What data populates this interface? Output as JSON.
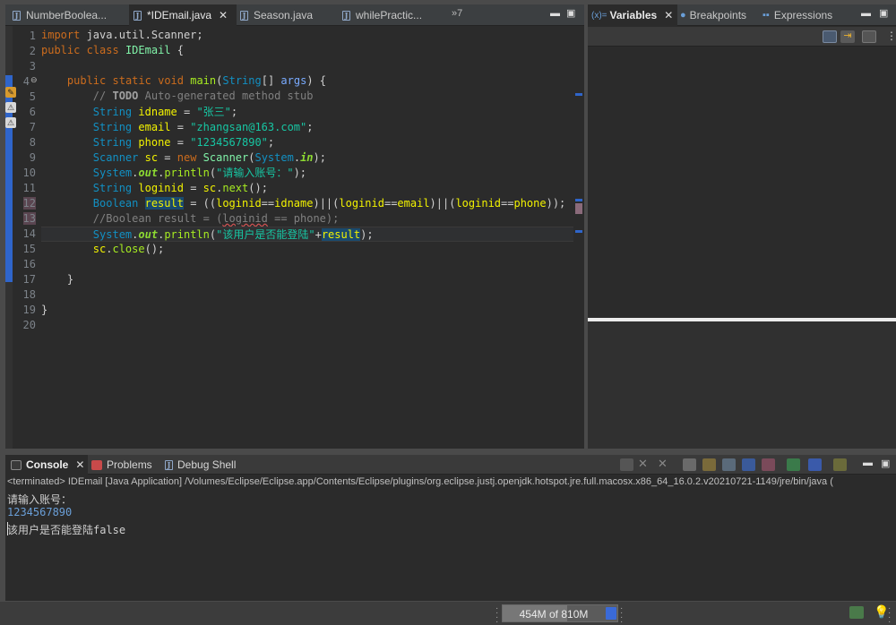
{
  "editor": {
    "tabs": [
      {
        "label": "NumberBoolea...",
        "active": false
      },
      {
        "label": "*IDEmail.java",
        "active": true
      },
      {
        "label": "Season.java",
        "active": false
      },
      {
        "label": "whilePractic...",
        "active": false
      }
    ],
    "overflow_label": "»7",
    "line_numbers": [
      "1",
      "2",
      "3",
      "4",
      "5",
      "6",
      "7",
      "8",
      "9",
      "10",
      "11",
      "12",
      "13",
      "14",
      "15",
      "16",
      "17",
      "18",
      "19",
      "20"
    ],
    "code": {
      "l1_kw": "import",
      "l1_rest": " java.util.Scanner;",
      "l2_kw1": "public",
      "l2_kw2": "class",
      "l2_name": "IDEmail",
      "l2_brace": " {",
      "l4_kw1": "public",
      "l4_kw2": "static",
      "l4_kw3": "void",
      "l4_fn": "main",
      "l4_type": "String",
      "l4_arr": "[] ",
      "l4_arg": "args",
      "l4_end": ") {",
      "l5_cm1": "// ",
      "l5_todo": "TODO",
      "l5_cm2": " Auto-generated method stub",
      "l6_type": "String",
      "l6_var": "idname",
      "l6_str": "\"张三\"",
      "l7_type": "String",
      "l7_var": "email",
      "l7_str": "\"zhangsan@163.com\"",
      "l8_type": "String",
      "l8_var": "phone",
      "l8_str": "\"1234567890\"",
      "l9_type": "Scanner",
      "l9_var": "sc",
      "l9_kw": "new",
      "l9_ctor": "Scanner",
      "l9_sys": "System",
      "l9_fld": "in",
      "l10_sys": "System",
      "l10_fld": "out",
      "l10_fn": "println",
      "l10_str": "\"请输入账号：\"",
      "l11_type": "String",
      "l11_var": "loginid",
      "l11_obj": "sc",
      "l11_fn": "next",
      "l12_type": "Boolean",
      "l12_var": "result",
      "l12_v1": "loginid",
      "l12_v2": "idname",
      "l12_v3": "loginid",
      "l12_v4": "email",
      "l12_v5": "loginid",
      "l12_v6": "phone",
      "l13_cm1": "//Boolean result = (",
      "l13_sq": "loginid",
      "l13_cm2": " == phone);",
      "l14_sys": "System",
      "l14_fld": "out",
      "l14_fn": "println",
      "l14_str": "\"该用户是否能登陆\"",
      "l14_var": "result",
      "l15_obj": "sc",
      "l15_fn": "close",
      "l17_brace": "}",
      "l19_brace": "}"
    }
  },
  "views": {
    "tabs": [
      {
        "label": "Variables",
        "icon": "variables-icon",
        "active": true
      },
      {
        "label": "Breakpoints",
        "icon": "breakpoints-icon",
        "active": false
      },
      {
        "label": "Expressions",
        "icon": "expressions-icon",
        "active": false
      }
    ],
    "variables_icon_text": "(x)="
  },
  "console": {
    "tabs": [
      {
        "label": "Console",
        "active": true
      },
      {
        "label": "Problems",
        "active": false
      },
      {
        "label": "Debug Shell",
        "active": false
      }
    ],
    "terminated_line": "<terminated> IDEmail [Java Application] /Volumes/Eclipse/Eclipse.app/Contents/Eclipse/plugins/org.eclipse.justj.openjdk.hotspot.jre.full.macosx.x86_64_16.0.2.v20210721-1149/jre/bin/java  (",
    "output": [
      {
        "text": "请输入账号：",
        "color": "#d8d8d8"
      },
      {
        "text": "1234567890",
        "color": "#6a9fd8"
      },
      {
        "text": "该用户是否能登陆false",
        "color": "#d8d8d8"
      }
    ]
  },
  "status": {
    "heap_used": "454M",
    "heap_of": "of",
    "heap_total": "810M",
    "heap_fraction": 0.56
  },
  "colors": {
    "accent_blue": "#2f65ca",
    "keyword": "#cc6c1d",
    "type": "#1290c3",
    "string": "#17c6a3",
    "variable": "#f2f200"
  }
}
